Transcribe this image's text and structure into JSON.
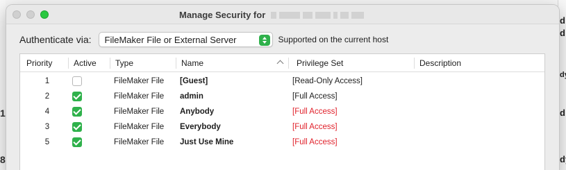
{
  "window": {
    "title": "Manage Security for"
  },
  "auth": {
    "label": "Authenticate via:",
    "selected": "FileMaker File or External Server",
    "note": "Supported on the current host"
  },
  "table": {
    "columns": [
      "Priority",
      "Active",
      "Type",
      "Name",
      "Privilege Set",
      "Description"
    ],
    "rows": [
      {
        "priority": "1",
        "active": false,
        "type": "FileMaker File",
        "name": "[Guest]",
        "privilege": "[Read-Only Access]",
        "privilege_color": "#1d1d1d"
      },
      {
        "priority": "2",
        "active": true,
        "type": "FileMaker File",
        "name": "admin",
        "privilege": "[Full Access]",
        "privilege_color": "#1d1d1d"
      },
      {
        "priority": "4",
        "active": true,
        "type": "FileMaker File",
        "name": "Anybody",
        "privilege": "[Full Access]",
        "privilege_color": "#e0202a"
      },
      {
        "priority": "3",
        "active": true,
        "type": "FileMaker File",
        "name": "Everybody",
        "privilege": "[Full Access]",
        "privilege_color": "#e0202a"
      },
      {
        "priority": "5",
        "active": true,
        "type": "FileMaker File",
        "name": "Just Use Mine",
        "privilege": "[Full Access]",
        "privilege_color": "#e0202a"
      }
    ]
  },
  "colors": {
    "accent_green": "#2fb14b",
    "warning_red": "#e0202a"
  },
  "background": {
    "right_glyphs": [
      "d",
      "d",
      "dy",
      "d",
      "dy"
    ],
    "left_glyphs": [
      "1",
      "8"
    ]
  }
}
